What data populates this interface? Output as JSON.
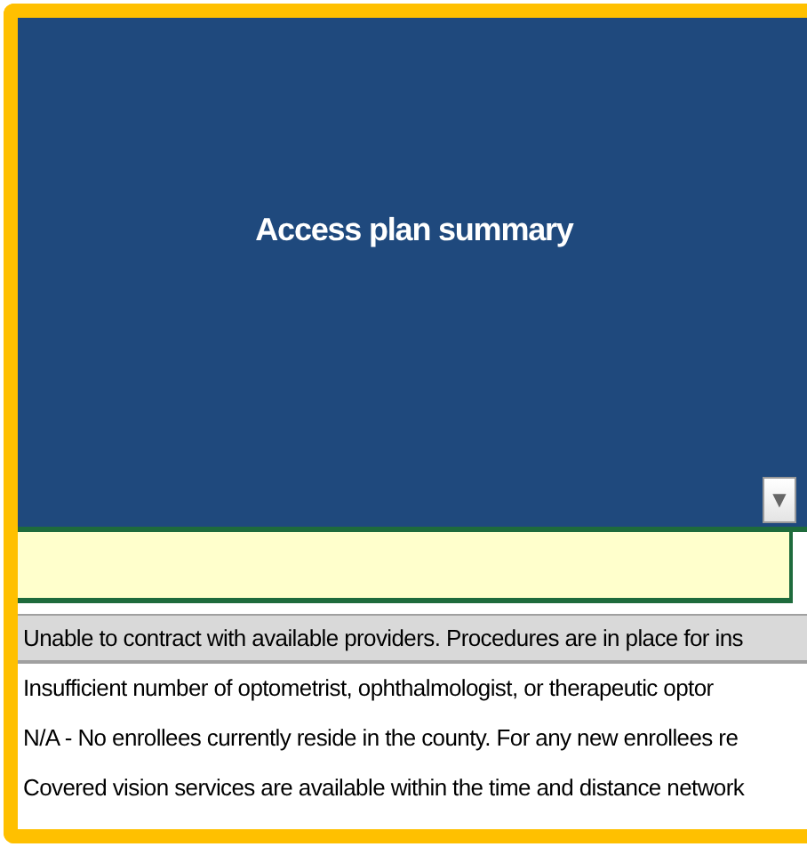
{
  "header": {
    "title": "Access plan summary"
  },
  "dropdown_button": {
    "icon": "▼"
  },
  "options": [
    {
      "label": "Unable to contract with available providers. Procedures are in place for ins",
      "selected": true
    },
    {
      "label": "Insufficient number of optometrist, ophthalmologist, or therapeutic optor",
      "selected": false
    },
    {
      "label": "N/A - No enrollees currently reside in the county. For any new enrollees re",
      "selected": false
    },
    {
      "label": "Covered vision services are available within the time and distance network",
      "selected": false
    }
  ]
}
